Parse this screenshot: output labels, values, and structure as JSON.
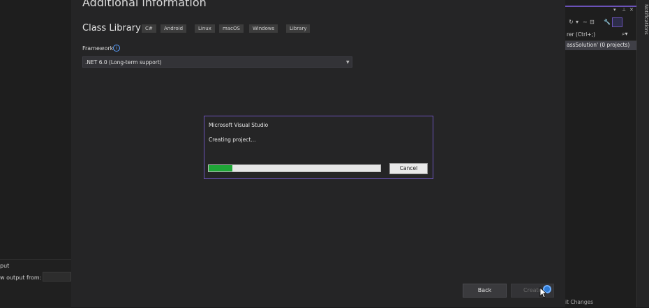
{
  "dialog": {
    "title": "Additional information",
    "project_type": "Class Library",
    "tags": [
      "C#",
      "Android",
      "Linux",
      "macOS",
      "Windows",
      "Library"
    ],
    "framework_label": "Framework",
    "framework_value": ".NET 6.0 (Long-term support)",
    "back_label": "Back",
    "create_label": "Create"
  },
  "progress_dialog": {
    "title": "Microsoft Visual Studio",
    "message": "Creating project...",
    "progress_fraction": 0.14,
    "cancel_label": "Cancel"
  },
  "output_panel": {
    "title": "put",
    "show_output_label": "w output from:"
  },
  "solution_explorer": {
    "search_placeholder": "rer (Ctrl+;)",
    "solution_item": "assSolution' (0 projects)",
    "git_changes": "it Changes"
  },
  "notifications_label": "Notifications",
  "colors": {
    "accent": "#6b52b8",
    "progress": "#1fa637",
    "spinner": "#2e7bd6"
  }
}
